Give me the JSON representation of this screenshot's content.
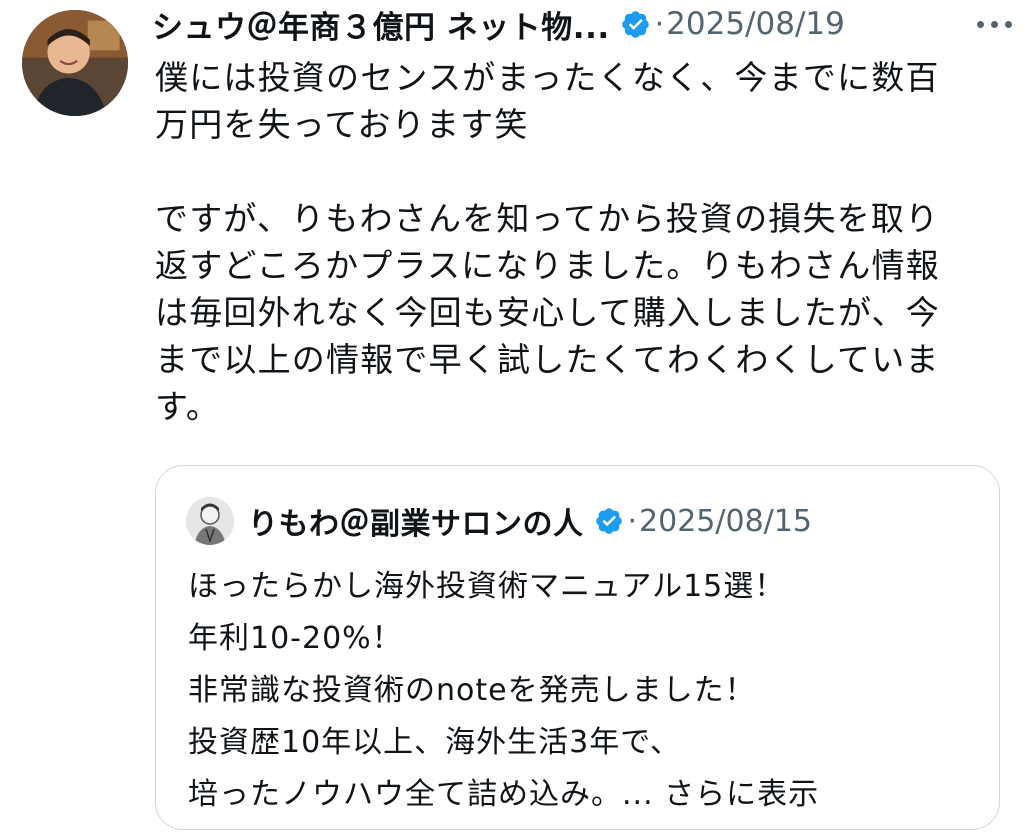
{
  "tweet": {
    "author_name": "シュウ＠年商３億円 ネット物...",
    "separator": "·",
    "date": "2025/08/19",
    "paragraph1": [
      "僕には投資のセンスがまったくなく、今までに数百",
      "万円を失っております笑"
    ],
    "paragraph2": [
      "ですが、りもわさんを知ってから投資の損失を取り",
      "返すどころかプラスになりました。りもわさん情報",
      "は毎回外れなく今回も安心して購入しましたが、今",
      "まで以上の情報で早く試したくてわくわくしていま",
      "す。"
    ]
  },
  "quote": {
    "author_name": "りもわ＠副業サロンの人",
    "separator": "·",
    "date": "2025/08/15",
    "lines": [
      "ほったらかし海外投資術マニュアル15選！",
      "年利10-20%！",
      "非常識な投資術のnoteを発売しました！",
      "投資歴10年以上、海外生活3年で、"
    ],
    "last_line": "培ったノウハウ全て詰め込み。",
    "show_more": "... さらに表示"
  },
  "icons": {
    "verified": "verified-badge-icon",
    "more": "more-options-icon"
  },
  "colors": {
    "verified_blue": "#1d9bf0",
    "secondary_text": "#536471",
    "border": "#cfd9de"
  }
}
